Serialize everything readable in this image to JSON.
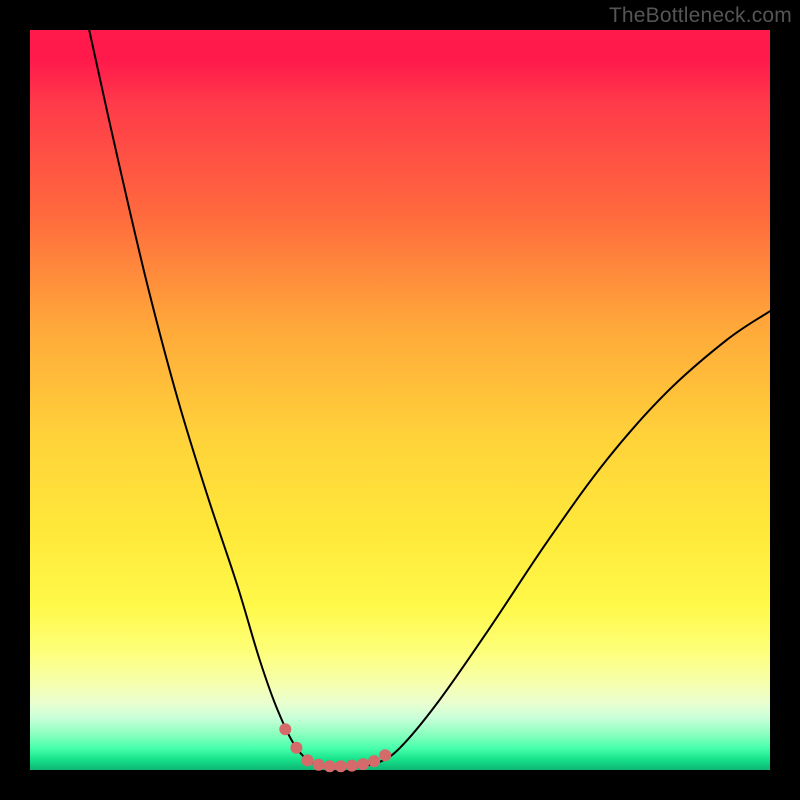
{
  "watermark": "TheBottleneck.com",
  "colors": {
    "page_bg": "#000000",
    "curve_stroke": "#000000",
    "marker_fill": "#d46a6a",
    "watermark_text": "#555555",
    "gradient_top": "#ff1a4b",
    "gradient_bottom": "#0fb574"
  },
  "chart_data": {
    "type": "line",
    "title": "",
    "xlabel": "",
    "ylabel": "",
    "xlim": [
      0,
      100
    ],
    "ylim": [
      0,
      100
    ],
    "grid": false,
    "legend": false,
    "annotations": [],
    "series": [
      {
        "name": "bottleneck-curve",
        "x": [
          8,
          12,
          16,
          20,
          24,
          28,
          31,
          33.5,
          36,
          38.5,
          41,
          44,
          47,
          50,
          55,
          62,
          70,
          78,
          86,
          94,
          100
        ],
        "values": [
          100,
          82,
          65,
          50,
          37,
          25,
          15,
          8,
          3,
          0.8,
          0.5,
          0.5,
          1,
          3,
          9,
          19,
          31,
          42,
          51,
          58,
          62
        ]
      }
    ],
    "markers": {
      "name": "highlight-dots",
      "x": [
        34.5,
        36,
        37.5,
        39,
        40.5,
        42,
        43.5,
        45,
        46.5,
        48
      ],
      "values": [
        5.5,
        3,
        1.3,
        0.7,
        0.5,
        0.5,
        0.6,
        0.8,
        1.2,
        2
      ],
      "radius_px": 6
    }
  }
}
